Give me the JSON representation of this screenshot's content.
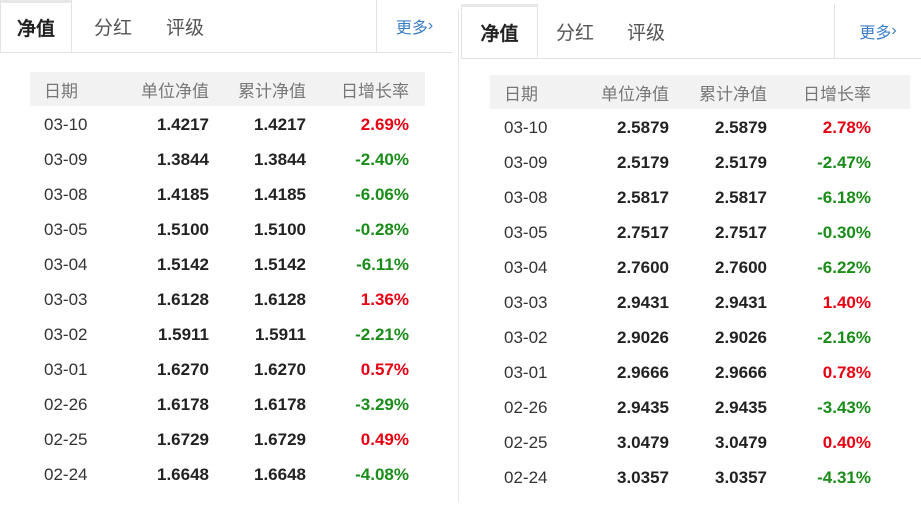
{
  "left": {
    "tabs": [
      "净值",
      "分红",
      "评级"
    ],
    "more": "更多",
    "headers": [
      "日期",
      "单位净值",
      "累计净值",
      "日增长率"
    ],
    "rows": [
      {
        "date": "03-10",
        "unit": "1.4217",
        "cum": "1.4217",
        "pct": "2.69%",
        "dir": "up"
      },
      {
        "date": "03-09",
        "unit": "1.3844",
        "cum": "1.3844",
        "pct": "-2.40%",
        "dir": "down"
      },
      {
        "date": "03-08",
        "unit": "1.4185",
        "cum": "1.4185",
        "pct": "-6.06%",
        "dir": "down"
      },
      {
        "date": "03-05",
        "unit": "1.5100",
        "cum": "1.5100",
        "pct": "-0.28%",
        "dir": "down"
      },
      {
        "date": "03-04",
        "unit": "1.5142",
        "cum": "1.5142",
        "pct": "-6.11%",
        "dir": "down"
      },
      {
        "date": "03-03",
        "unit": "1.6128",
        "cum": "1.6128",
        "pct": "1.36%",
        "dir": "up"
      },
      {
        "date": "03-02",
        "unit": "1.5911",
        "cum": "1.5911",
        "pct": "-2.21%",
        "dir": "down"
      },
      {
        "date": "03-01",
        "unit": "1.6270",
        "cum": "1.6270",
        "pct": "0.57%",
        "dir": "up"
      },
      {
        "date": "02-26",
        "unit": "1.6178",
        "cum": "1.6178",
        "pct": "-3.29%",
        "dir": "down"
      },
      {
        "date": "02-25",
        "unit": "1.6729",
        "cum": "1.6729",
        "pct": "0.49%",
        "dir": "up"
      },
      {
        "date": "02-24",
        "unit": "1.6648",
        "cum": "1.6648",
        "pct": "-4.08%",
        "dir": "down"
      }
    ]
  },
  "right": {
    "tabs": [
      "净值",
      "分红",
      "评级"
    ],
    "more": "更多",
    "headers": [
      "日期",
      "单位净值",
      "累计净值",
      "日增长率"
    ],
    "rows": [
      {
        "date": "03-10",
        "unit": "2.5879",
        "cum": "2.5879",
        "pct": "2.78%",
        "dir": "up"
      },
      {
        "date": "03-09",
        "unit": "2.5179",
        "cum": "2.5179",
        "pct": "-2.47%",
        "dir": "down"
      },
      {
        "date": "03-08",
        "unit": "2.5817",
        "cum": "2.5817",
        "pct": "-6.18%",
        "dir": "down"
      },
      {
        "date": "03-05",
        "unit": "2.7517",
        "cum": "2.7517",
        "pct": "-0.30%",
        "dir": "down"
      },
      {
        "date": "03-04",
        "unit": "2.7600",
        "cum": "2.7600",
        "pct": "-6.22%",
        "dir": "down"
      },
      {
        "date": "03-03",
        "unit": "2.9431",
        "cum": "2.9431",
        "pct": "1.40%",
        "dir": "up"
      },
      {
        "date": "03-02",
        "unit": "2.9026",
        "cum": "2.9026",
        "pct": "-2.16%",
        "dir": "down"
      },
      {
        "date": "03-01",
        "unit": "2.9666",
        "cum": "2.9666",
        "pct": "0.78%",
        "dir": "up"
      },
      {
        "date": "02-26",
        "unit": "2.9435",
        "cum": "2.9435",
        "pct": "-3.43%",
        "dir": "down"
      },
      {
        "date": "02-25",
        "unit": "3.0479",
        "cum": "3.0479",
        "pct": "0.40%",
        "dir": "up"
      },
      {
        "date": "02-24",
        "unit": "3.0357",
        "cum": "3.0357",
        "pct": "-4.31%",
        "dir": "down"
      }
    ]
  },
  "colors": {
    "up": "#e60012",
    "down": "#1a8c1a",
    "link": "#3a7ec8",
    "header_bg": "#f2f2f2"
  }
}
